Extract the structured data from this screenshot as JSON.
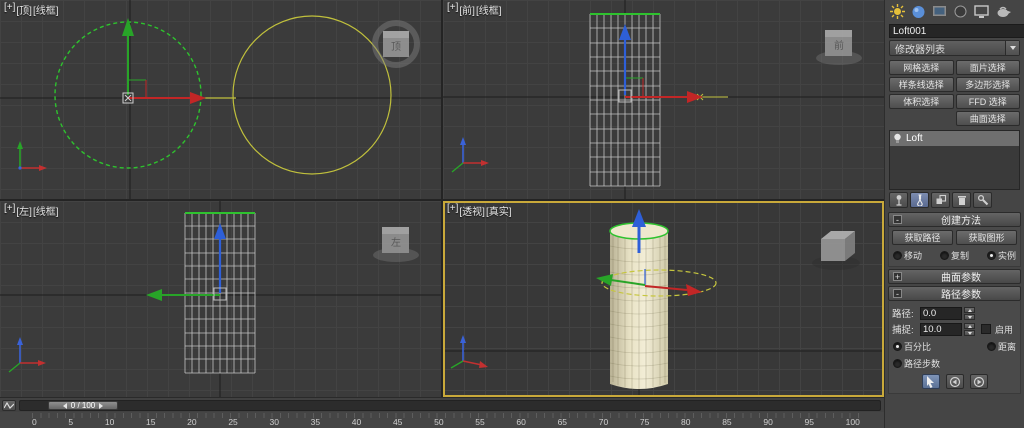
{
  "colors": {
    "active_viewport_border": "#c9a93a",
    "selection_green": "#2ec22e",
    "shape_yellow": "#c6c63e",
    "axis_x_red": "#c22626",
    "axis_y_green": "#28a428",
    "axis_z_blue": "#2e5fd8"
  },
  "viewports": {
    "top": {
      "label_plus": "[+]",
      "label_view": "[顶]",
      "label_shading": "[线框]",
      "cube_label": "顶"
    },
    "front": {
      "label_plus": "[+]",
      "label_view": "[前]",
      "label_shading": "[线框]",
      "cube_label": "前"
    },
    "left": {
      "label_plus": "[+]",
      "label_view": "[左]",
      "label_shading": "[线框]",
      "cube_label": "左"
    },
    "perspective": {
      "label_plus": "[+]",
      "label_view": "[透视]",
      "label_shading": "[真实]"
    }
  },
  "timeline": {
    "frame_indicator": "0 / 100",
    "ticks": [
      "0",
      "5",
      "10",
      "15",
      "20",
      "25",
      "30",
      "35",
      "40",
      "45",
      "50",
      "55",
      "60",
      "65",
      "70",
      "75",
      "80",
      "85",
      "90",
      "95",
      "100"
    ]
  },
  "toolbar_icons": [
    "render-setup",
    "material-editor",
    "rendered-frame-window",
    "environment-effects",
    "display-monitor",
    "render-production"
  ],
  "command_panel": {
    "object_name": "Loft001",
    "modifier_list": "修改器列表",
    "selection_buttons": [
      "网格选择",
      "面片选择",
      "样条线选择",
      "多边形选择",
      "体积选择",
      "FFD 选择",
      "",
      "曲面选择"
    ],
    "modifier_stack": [
      "Loft"
    ],
    "stack_toolbar_icons": [
      "pin-stack",
      "show-end-result",
      "make-unique",
      "remove-modifier",
      "configure-modifier-sets"
    ],
    "rollouts": {
      "creation_method": {
        "marker": "-",
        "title": "创建方法",
        "buttons": [
          "获取路径",
          "获取图形"
        ],
        "options": [
          "移动",
          "复制",
          "实例"
        ],
        "selected_option": "实例"
      },
      "surface_params": {
        "marker": "+",
        "title": "曲面参数"
      },
      "path_params": {
        "marker": "-",
        "title": "路径参数",
        "path_label": "路径:",
        "path_value": "0.0",
        "snap_label": "捕捉:",
        "snap_value": "10.0",
        "enable_label": "启用",
        "options": [
          "百分比",
          "距离",
          "路径步数"
        ],
        "selected_option": "百分比",
        "buttons": [
          "pick-shape",
          "previous-shape",
          "next-shape"
        ]
      }
    }
  }
}
